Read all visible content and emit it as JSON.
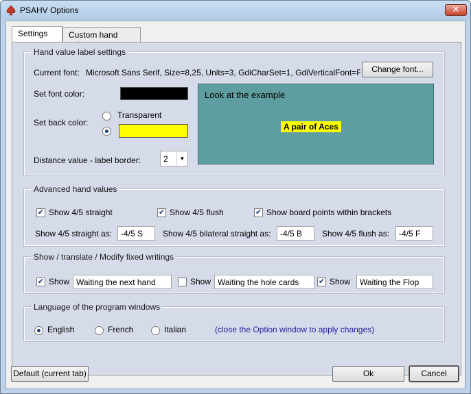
{
  "window": {
    "title": "PSAHV Options",
    "close_glyph": "✕"
  },
  "tabs": [
    {
      "label": "Settings",
      "active": true
    },
    {
      "label": "Custom hand values",
      "active": false
    }
  ],
  "label_settings": {
    "title": "Hand value label settings",
    "current_font_label": "Current font:",
    "current_font_value": "Microsoft Sans Serif, Size=8,25, Units=3, GdiCharSet=1, GdiVerticalFont=F",
    "change_font_button": "Change font...",
    "font_color_label": "Set font color:",
    "font_color": "#000000",
    "back_color_label": "Set back color:",
    "transparent_label": "Transparent",
    "transparent_selected": false,
    "color_selected": true,
    "back_color": "#ffff00",
    "distance_label": "Distance value - label border:",
    "distance_value": "2",
    "preview_text": "Look at the example",
    "preview_label": "A pair of Aces",
    "preview_bg": "#5f9ea0"
  },
  "advanced": {
    "title": "Advanced hand values",
    "show_straight_label": "Show  4/5 straight",
    "show_straight_checked": true,
    "show_flush_label": "Show 4/5 flush",
    "show_flush_checked": true,
    "show_board_label": "Show board points within brackets",
    "show_board_checked": true,
    "straight_as_label": "Show 4/5 straight as:",
    "straight_as_value": "-4/5 S",
    "bilateral_as_label": "Show 4/5 bilateral straight as:",
    "bilateral_as_value": "-4/5 B",
    "flush_as_label": "Show 4/5 flush as:",
    "flush_as_value": "-4/5 F"
  },
  "writings": {
    "title": "Show / translate / Modify fixed writings",
    "show_label": "Show",
    "items": [
      {
        "checked": true,
        "value": "Waiting the next hand"
      },
      {
        "checked": false,
        "value": "Waiting the hole cards"
      },
      {
        "checked": true,
        "value": "Waiting the Flop"
      }
    ]
  },
  "language": {
    "title": "Language of the program windows",
    "options": [
      {
        "label": "English",
        "selected": true
      },
      {
        "label": "French",
        "selected": false
      },
      {
        "label": "Italian",
        "selected": false
      }
    ],
    "note": "(close the Option window to apply changes)",
    "note_color": "#1f1f9e"
  },
  "footer": {
    "default_button": "Default (current tab)",
    "ok_button": "Ok",
    "cancel_button": "Cancel"
  }
}
